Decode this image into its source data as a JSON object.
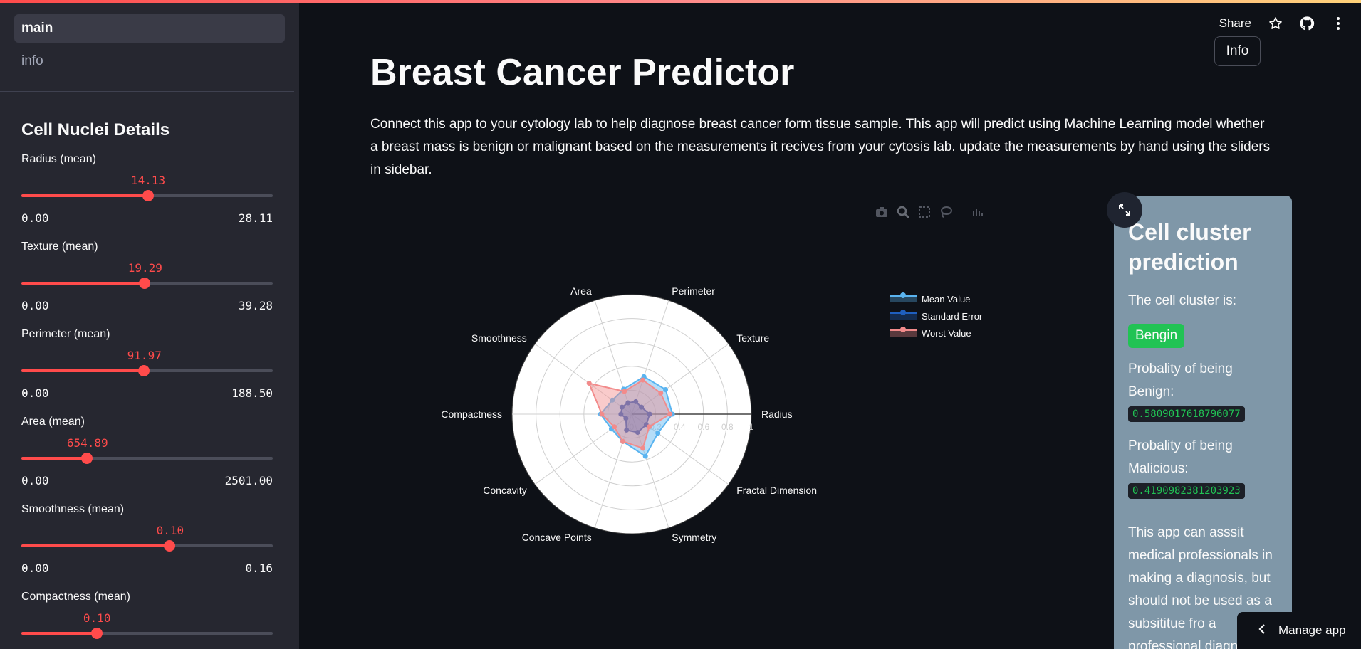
{
  "nav": {
    "items": [
      {
        "label": "main",
        "active": true
      },
      {
        "label": "info",
        "active": false
      }
    ]
  },
  "sidebar": {
    "title": "Cell Nuclei Details",
    "sliders": [
      {
        "label": "Radius (mean)",
        "value": "14.13",
        "min": "0.00",
        "max": "28.11",
        "fraction": 0.503
      },
      {
        "label": "Texture (mean)",
        "value": "19.29",
        "min": "0.00",
        "max": "39.28",
        "fraction": 0.491
      },
      {
        "label": "Perimeter (mean)",
        "value": "91.97",
        "min": "0.00",
        "max": "188.50",
        "fraction": 0.488
      },
      {
        "label": "Area (mean)",
        "value": "654.89",
        "min": "0.00",
        "max": "2501.00",
        "fraction": 0.262
      },
      {
        "label": "Smoothness (mean)",
        "value": "0.10",
        "min": "0.00",
        "max": "0.16",
        "fraction": 0.59
      },
      {
        "label": "Compactness (mean)",
        "value": "0.10",
        "min": "0.00",
        "max": "",
        "fraction": 0.3
      }
    ]
  },
  "header": {
    "share_label": "Share",
    "icons": [
      "star-icon",
      "github-icon",
      "more-icon"
    ]
  },
  "main": {
    "info_button": "Info",
    "title": "Breast Cancer Predictor",
    "intro": "Connect this app to your cytology lab to help diagnose breast cancer form tissue sample. This app will predict using Machine Learning model whether a breast mass is benign or malignant based on the measurements it recives from your cytosis lab. update the measurements by hand using the sliders in sidebar."
  },
  "chart_data": {
    "type": "radar",
    "categories": [
      "Radius",
      "Texture",
      "Perimeter",
      "Area",
      "Smoothness",
      "Compactness",
      "Concavity",
      "Concave Points",
      "Symmetry",
      "Fractal Dimension"
    ],
    "radial_range": [
      0,
      1
    ],
    "radial_ticks": [
      "0",
      "0.2",
      "0.4",
      "0.6",
      "0.8",
      "1"
    ],
    "series": [
      {
        "name": "Mean Value",
        "color": "#5ab4f0",
        "values": [
          0.34,
          0.35,
          0.33,
          0.22,
          0.2,
          0.26,
          0.21,
          0.24,
          0.37,
          0.27
        ]
      },
      {
        "name": "Standard Error",
        "color": "#1f5fbf",
        "values": [
          0.15,
          0.1,
          0.11,
          0.1,
          0.1,
          0.09,
          0.06,
          0.14,
          0.16,
          0.15
        ]
      },
      {
        "name": "Worst Value",
        "color": "#f28b8b",
        "values": [
          0.32,
          0.3,
          0.3,
          0.2,
          0.44,
          0.25,
          0.18,
          0.24,
          0.3,
          0.18
        ]
      }
    ]
  },
  "prediction": {
    "title": "Cell cluster prediction",
    "cluster_label": "The cell cluster is:",
    "result": "Bengin",
    "benign_label": "Probality of being Benign:",
    "benign_value": "0.5809017618796077",
    "malicious_label": "Probality of being Malicious:",
    "malicious_value": "0.4190982381203923",
    "disclaimer": "This app can asssit medical professionals in making a diagnosis, but should not be used as a subsititue fro a professional diagnosis."
  },
  "footer": {
    "manage_label": "Manage app"
  },
  "colors": {
    "accent": "#ff4b4b",
    "sidebar": "#262730",
    "background": "#0e1117",
    "panel": "#7f97a8",
    "success": "#21c354"
  }
}
